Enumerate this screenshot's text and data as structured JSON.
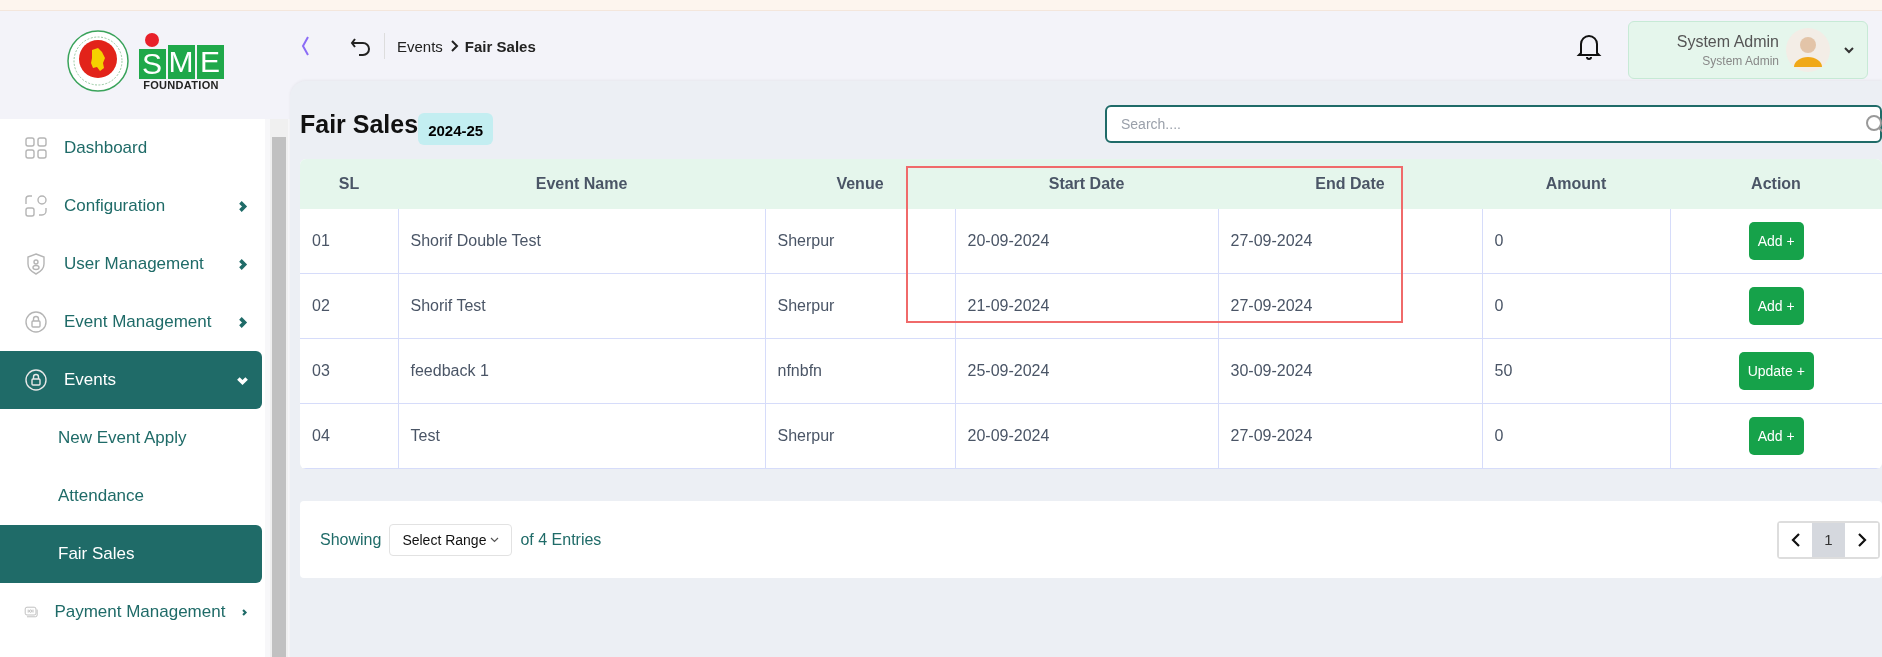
{
  "logo": {
    "letters": [
      "S",
      "M",
      "E"
    ],
    "caption": "FOUNDATION"
  },
  "breadcrumb": {
    "items": [
      "Events"
    ],
    "current": "Fair Sales"
  },
  "user": {
    "name": "System Admin",
    "role": "System Admin"
  },
  "sidebar": {
    "items": [
      {
        "label": "Dashboard",
        "selected": false
      },
      {
        "label": "Configuration",
        "expanded": false,
        "selected": false
      },
      {
        "label": "User Management",
        "expanded": false,
        "selected": false
      },
      {
        "label": "Event Management",
        "expanded": false,
        "selected": false
      },
      {
        "label": "Events",
        "expanded": true,
        "selected": true,
        "children": [
          {
            "label": "New Event Apply",
            "selected": false
          },
          {
            "label": "Attendance",
            "selected": false
          },
          {
            "label": "Fair Sales",
            "selected": true
          }
        ]
      },
      {
        "label": "Payment Management",
        "expanded": false,
        "selected": false
      }
    ]
  },
  "page": {
    "title": "Fair Sales",
    "badge": "2024-25"
  },
  "search": {
    "placeholder": "Search...."
  },
  "table": {
    "columns": [
      "SL",
      "Event Name",
      "Venue",
      "Start Date",
      "End Date",
      "Amount",
      "Action"
    ],
    "rows": [
      {
        "sl": "01",
        "event_name": "Shorif Double Test",
        "venue": "Sherpur",
        "start_date": "20-09-2024",
        "end_date": "27-09-2024",
        "amount": "0",
        "action": "Add +"
      },
      {
        "sl": "02",
        "event_name": "Shorif Test",
        "venue": "Sherpur",
        "start_date": "21-09-2024",
        "end_date": "27-09-2024",
        "amount": "0",
        "action": "Add +"
      },
      {
        "sl": "03",
        "event_name": "feedback 1",
        "venue": "nfnbfn",
        "start_date": "25-09-2024",
        "end_date": "30-09-2024",
        "amount": "50",
        "action": "Update +"
      },
      {
        "sl": "04",
        "event_name": "Test",
        "venue": "Sherpur",
        "start_date": "20-09-2024",
        "end_date": "27-09-2024",
        "amount": "0",
        "action": "Add +"
      }
    ]
  },
  "footer": {
    "showing": "Showing",
    "range_select": "Select Range",
    "entries": "of 4 Entries",
    "pages": [
      {
        "label": "1",
        "selected": true
      }
    ]
  }
}
